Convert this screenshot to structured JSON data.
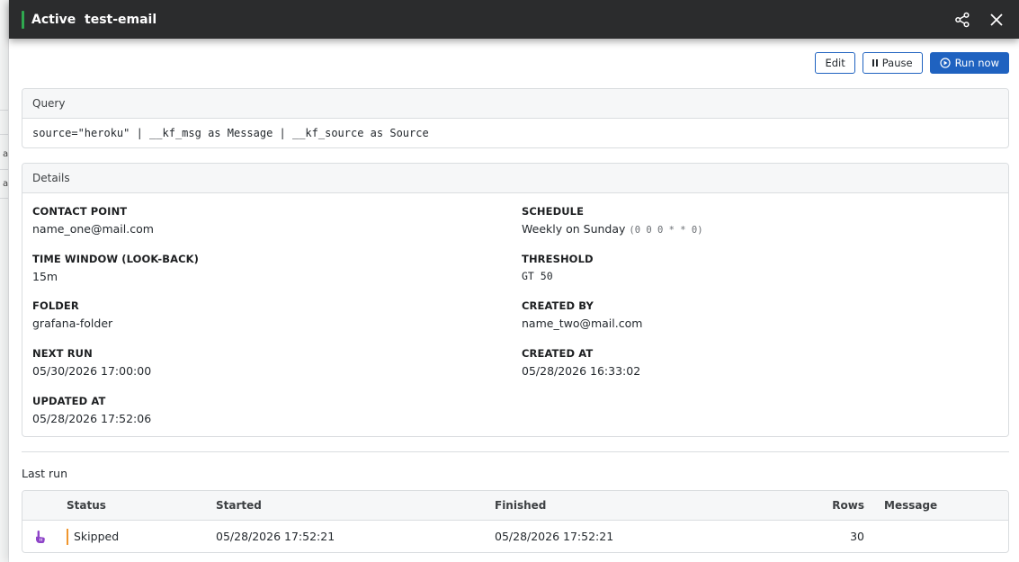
{
  "background": {
    "letters": [
      "a",
      "a"
    ]
  },
  "header": {
    "status": "Active",
    "name": "test-email",
    "share_icon": "share-icon",
    "close_icon": "close-icon",
    "accent_color": "#2fa84f"
  },
  "toolbar": {
    "edit_label": "Edit",
    "pause_label": "Pause",
    "run_now_label": "Run now",
    "primary_color": "#1f62c0"
  },
  "query": {
    "heading": "Query",
    "text": "source=\"heroku\" | __kf_msg as Message | __kf_source as Source"
  },
  "details": {
    "heading": "Details",
    "contact_point": {
      "label": "CONTACT POINT",
      "value": "name_one@mail.com"
    },
    "schedule": {
      "label": "SCHEDULE",
      "value": "Weekly on Sunday",
      "cron": "(0 0 0 * * 0)"
    },
    "time_window": {
      "label": "TIME WINDOW (LOOK-BACK)",
      "value": "15m"
    },
    "threshold": {
      "label": "THRESHOLD",
      "value": "GT 50"
    },
    "folder": {
      "label": "FOLDER",
      "value": "grafana-folder"
    },
    "created_by": {
      "label": "CREATED BY",
      "value": "name_two@mail.com"
    },
    "next_run": {
      "label": "NEXT RUN",
      "value": "05/30/2026 17:00:00"
    },
    "created_at": {
      "label": "CREATED AT",
      "value": "05/28/2026 16:33:02"
    },
    "updated_at": {
      "label": "UPDATED AT",
      "value": "05/28/2026 17:52:06"
    }
  },
  "last_run": {
    "heading": "Last run",
    "columns": {
      "status": "Status",
      "started": "Started",
      "finished": "Finished",
      "rows": "Rows",
      "message": "Message"
    },
    "rows": [
      {
        "icon": "hand-pointer-icon",
        "status": "Skipped",
        "status_color": "#f0962e",
        "started": "05/28/2026 17:52:21",
        "finished": "05/28/2026 17:52:21",
        "rows": "30",
        "message": ""
      }
    ]
  }
}
